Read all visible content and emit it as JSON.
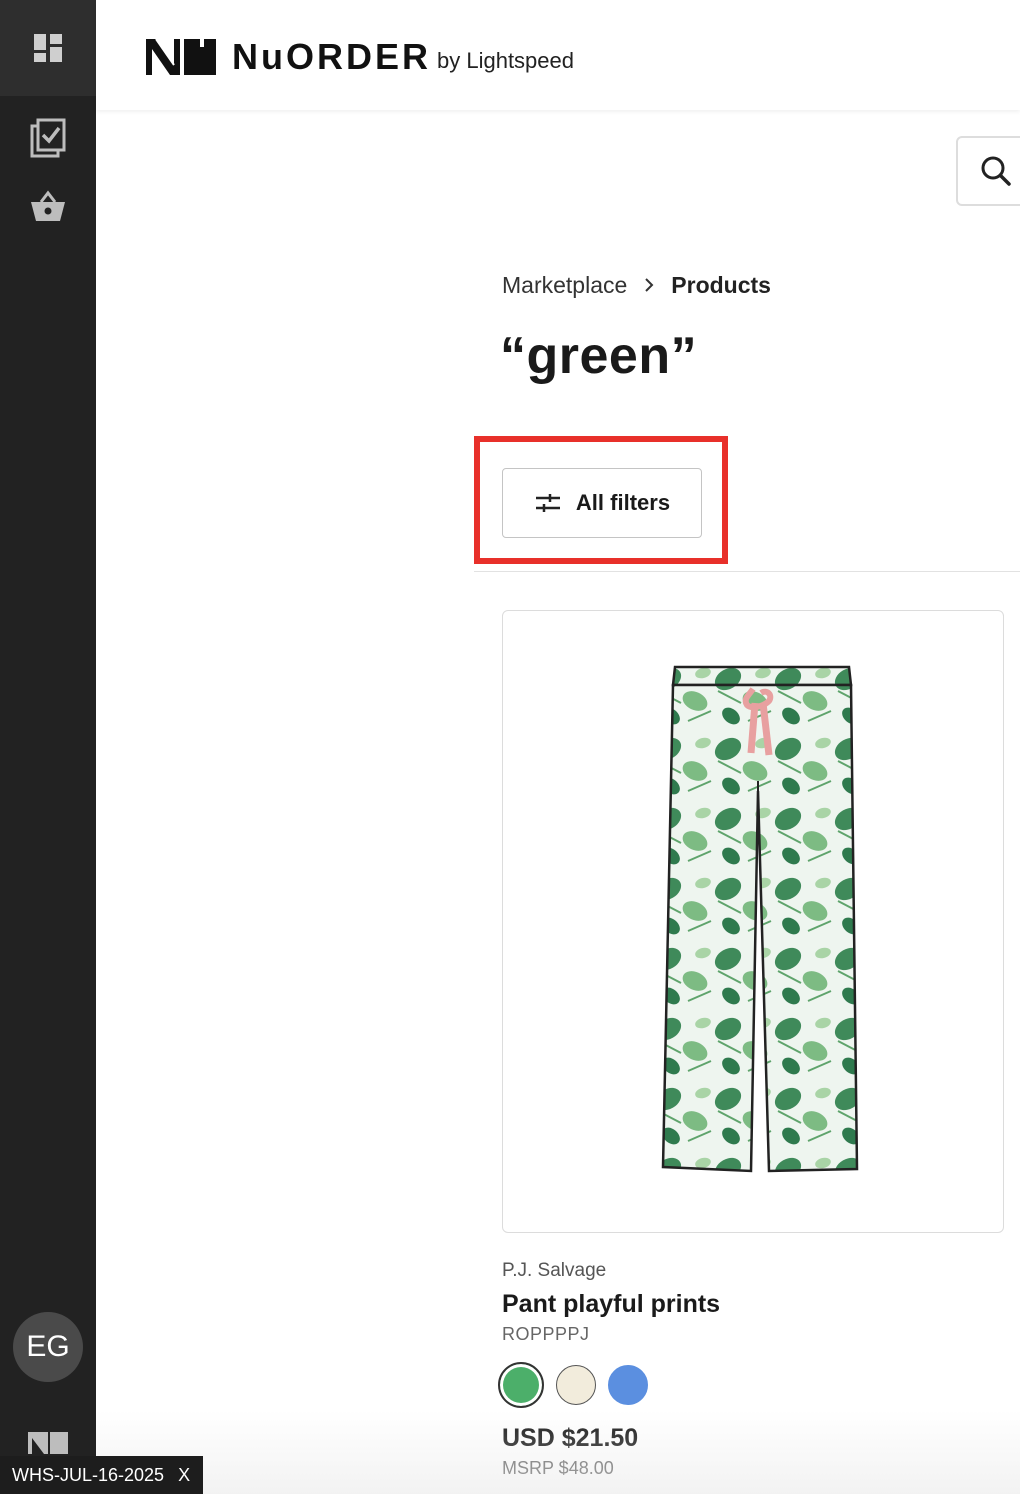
{
  "sidebar": {
    "icons": [
      "dashboard-icon",
      "checklist-icon",
      "basket-icon"
    ],
    "avatar_initials": "EG"
  },
  "header": {
    "brand_name": "NuORDER",
    "brand_by": "by Lightspeed"
  },
  "breadcrumb": {
    "items": [
      "Marketplace",
      "Products"
    ]
  },
  "page": {
    "title": "“green”"
  },
  "filters": {
    "label": "All filters"
  },
  "product": {
    "brand": "P.J. Salvage",
    "name": "Pant playful prints",
    "sku": "ROPPPPJ",
    "swatches": [
      "#4caf6a",
      "#f2ecdc",
      "#5b8fe0"
    ],
    "selected_swatch": 0,
    "price": "USD $21.50",
    "msrp": "MSRP $48.00"
  },
  "env_badge": {
    "label": "WHS-JUL-16-2025",
    "close": "X"
  },
  "colors": {
    "sidebar_bg": "#222222",
    "highlight": "#e8302a"
  }
}
